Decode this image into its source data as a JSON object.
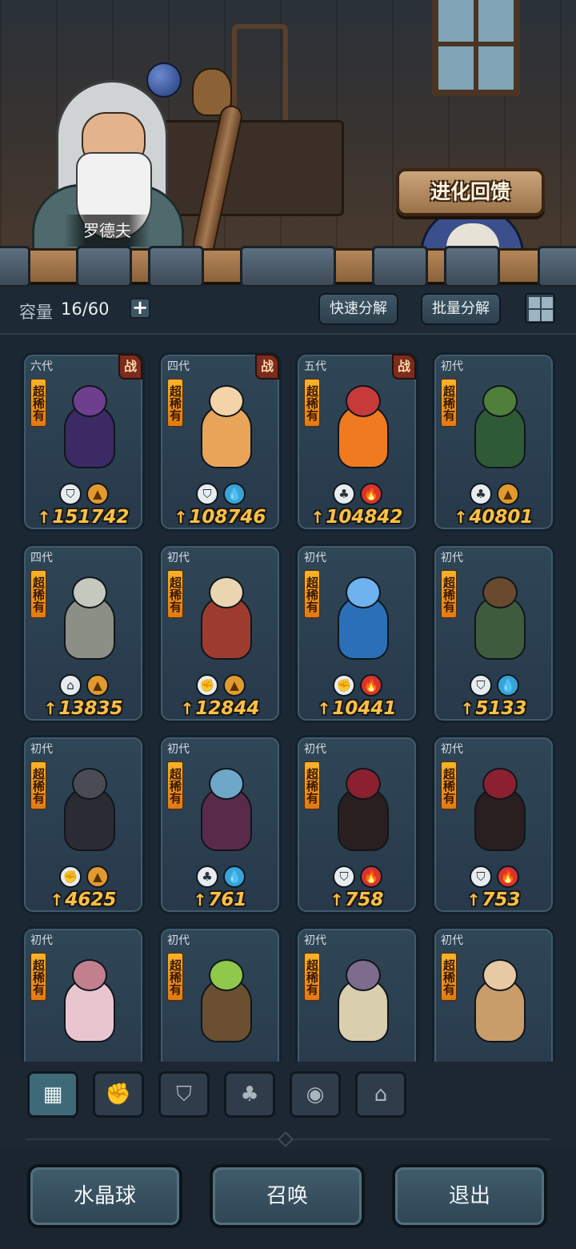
{
  "npc": {
    "name": "罗德夫"
  },
  "evolve_feedback": {
    "label": "进化回馈"
  },
  "toolbar": {
    "capacity_label": "容量",
    "capacity_value": "16/60",
    "add_label": "+",
    "quick_decompose": "快速分解",
    "batch_decompose": "批量分解"
  },
  "rarity_text": "超稀有",
  "battle_tag": "战",
  "colors": {
    "power": "#ffc043",
    "rarity_badge": "#f8b32a",
    "battle_tag": "#7a2c1f",
    "accent": "#3e6a78"
  },
  "cards": [
    {
      "gen": "六代",
      "battle": true,
      "power": "151742",
      "icons": [
        "shield-icon",
        "earth-icon"
      ]
    },
    {
      "gen": "四代",
      "battle": true,
      "power": "108746",
      "icons": [
        "shield-icon",
        "water-icon"
      ]
    },
    {
      "gen": "五代",
      "battle": true,
      "power": "104842",
      "icons": [
        "leaf-icon",
        "fire-icon"
      ]
    },
    {
      "gen": "初代",
      "battle": false,
      "power": "40801",
      "icons": [
        "leaf-icon",
        "earth-icon"
      ]
    },
    {
      "gen": "四代",
      "battle": false,
      "power": "13835",
      "icons": [
        "tower-icon",
        "earth-icon"
      ]
    },
    {
      "gen": "初代",
      "battle": false,
      "power": "12844",
      "icons": [
        "fist-icon",
        "earth-icon"
      ]
    },
    {
      "gen": "初代",
      "battle": false,
      "power": "10441",
      "icons": [
        "fist-icon",
        "fire-icon"
      ]
    },
    {
      "gen": "初代",
      "battle": false,
      "power": "5133",
      "icons": [
        "shield-icon",
        "water-icon"
      ]
    },
    {
      "gen": "初代",
      "battle": false,
      "power": "4625",
      "icons": [
        "fist-icon",
        "earth-icon"
      ]
    },
    {
      "gen": "初代",
      "battle": false,
      "power": "761",
      "icons": [
        "leaf-icon",
        "water-icon"
      ]
    },
    {
      "gen": "初代",
      "battle": false,
      "power": "758",
      "icons": [
        "shield-icon",
        "fire-icon"
      ]
    },
    {
      "gen": "初代",
      "battle": false,
      "power": "753",
      "icons": [
        "shield-icon",
        "fire-icon"
      ]
    },
    {
      "gen": "初代",
      "battle": false,
      "power": "",
      "icons": []
    },
    {
      "gen": "初代",
      "battle": false,
      "power": "",
      "icons": []
    },
    {
      "gen": "初代",
      "battle": false,
      "power": "",
      "icons": []
    },
    {
      "gen": "初代",
      "battle": false,
      "power": "",
      "icons": []
    }
  ],
  "filter_tabs": [
    {
      "icon": "all-blocks-icon",
      "active": true
    },
    {
      "icon": "fist-icon",
      "active": false
    },
    {
      "icon": "shield-icon",
      "active": false
    },
    {
      "icon": "leaf-icon",
      "active": false
    },
    {
      "icon": "alien-icon",
      "active": false
    },
    {
      "icon": "tower-icon",
      "active": false
    }
  ],
  "bottom": {
    "crystal_ball": "水晶球",
    "summon": "召唤",
    "exit": "退出"
  }
}
